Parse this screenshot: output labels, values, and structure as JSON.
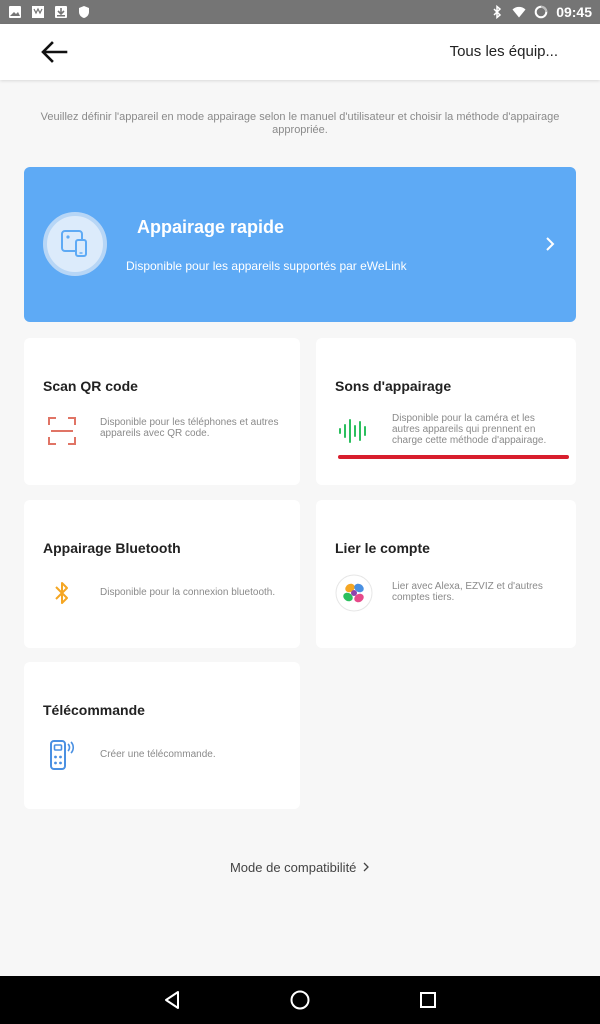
{
  "status_bar": {
    "time": "09:45",
    "left_icons": [
      "image-icon",
      "store-icon",
      "download-icon",
      "shield-icon"
    ],
    "right_icons": [
      "bluetooth-icon",
      "wifi-icon",
      "battery-charging-icon"
    ]
  },
  "header": {
    "back_icon": "arrow-left-icon",
    "right_label": "Tous les équip..."
  },
  "intro_text": "Veuillez définir l'appareil en mode appairage selon le manuel d'utilisateur et choisir la méthode d'appairage appropriée.",
  "quick_pairing": {
    "title": "Appairage rapide",
    "subtitle": "Disponible pour les appareils supportés par eWeLink",
    "color": "#5eaaf5"
  },
  "methods": [
    {
      "title": "Scan QR code",
      "description": "Disponible pour les téléphones et autres appareils avec QR code.",
      "icon": "scan-frame-icon"
    },
    {
      "title": "Sons d'appairage",
      "description": "Disponible pour la caméra et les autres appareils qui prennent en charge cette méthode d'appairage.",
      "icon": "sound-wave-icon"
    },
    {
      "title": "Appairage Bluetooth",
      "description": "Disponible pour la connexion bluetooth.",
      "icon": "bluetooth-icon"
    },
    {
      "title": "Lier le compte",
      "description": "Lier avec Alexa, EZVIZ et d'autres comptes tiers.",
      "icon": "link-account-icon"
    },
    {
      "title": "Télécommande",
      "description": "Créer une télécommande.",
      "icon": "remote-control-icon"
    }
  ],
  "compatibility_link": "Mode de compatibilité",
  "colors": {
    "accent_red": "#d81e2d",
    "sound_green": "#2bbf5e",
    "bluetooth_orange": "#f5a623",
    "remote_blue": "#4a90e2"
  },
  "nav_bar": [
    "back-triangle-icon",
    "home-circle-icon",
    "recents-square-icon"
  ]
}
